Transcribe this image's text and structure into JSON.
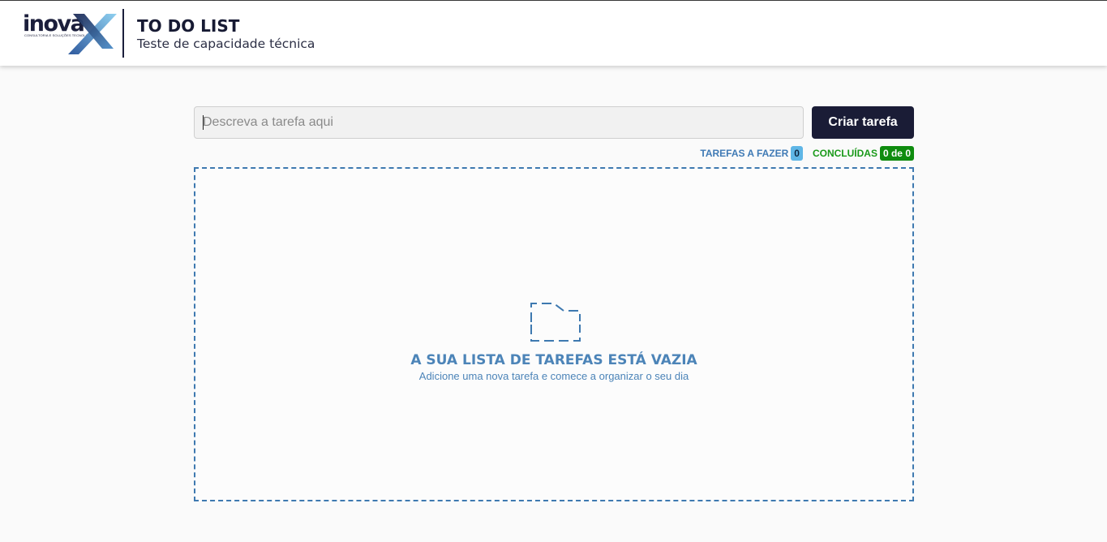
{
  "header": {
    "logo_word": "inova",
    "logo_tagline": "CONSULTORIA E SOLUÇÕES TECNOLÓGICAS",
    "title": "TO DO LIST",
    "subtitle": "Teste de capacidade técnica"
  },
  "form": {
    "input_placeholder": "Descreva a tarefa aqui",
    "input_value": "",
    "create_button_label": "Criar tarefa"
  },
  "counters": {
    "todo_label": "TAREFAS A FAZER",
    "todo_count": "0",
    "done_label": "CONCLUÍDAS",
    "done_count": "0 de 0"
  },
  "empty_state": {
    "icon": "folder-icon",
    "title": "A SUA LISTA DE TAREFAS ESTÁ VAZIA",
    "subtitle": "Adicione uma nova tarefa e comece a organizar o seu dia"
  },
  "colors": {
    "navy": "#1a1c36",
    "accent_blue": "#3e79b0",
    "todo_badge": "#5fb6e6",
    "done_green": "#0f8c0f"
  }
}
